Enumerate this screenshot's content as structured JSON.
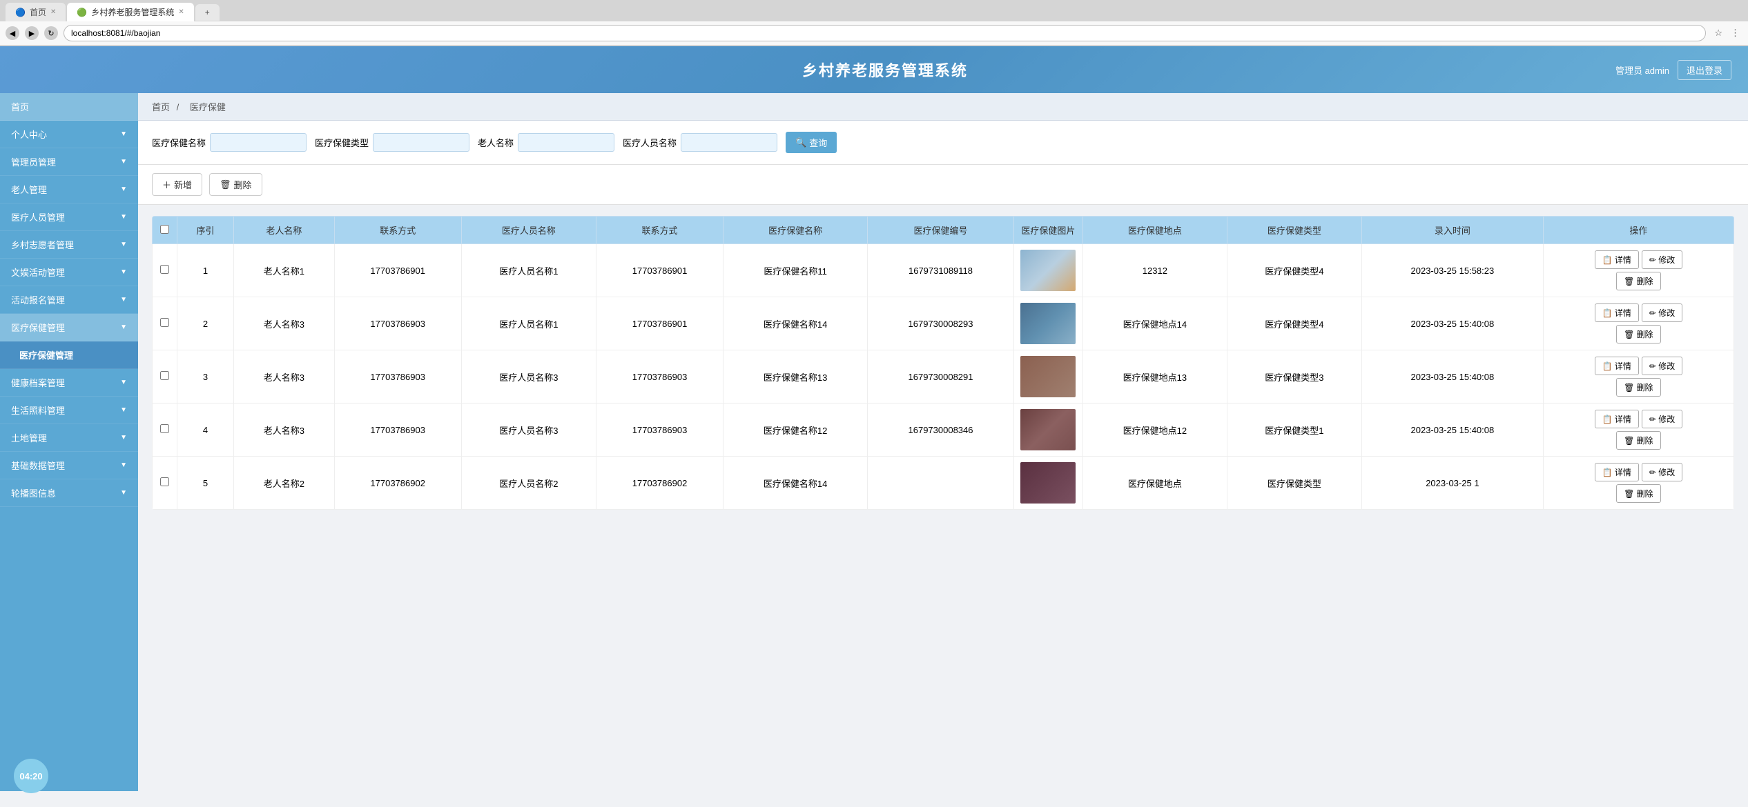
{
  "browser": {
    "tabs": [
      {
        "label": "首页",
        "active": false,
        "icon": "🔵"
      },
      {
        "label": "乡村养老服务管理系统",
        "active": true,
        "icon": "🟢"
      }
    ],
    "address": "localhost:8081/#/baojian",
    "new_tab": "+"
  },
  "header": {
    "title": "乡村养老服务管理系统",
    "admin_label": "管理员 admin",
    "logout_label": "退出登录"
  },
  "breadcrumb": {
    "home": "首页",
    "separator": "/",
    "current": "医疗保健"
  },
  "search": {
    "field1_label": "医疗保健名称",
    "field1_placeholder": "",
    "field2_label": "医疗保健类型",
    "field2_placeholder": "",
    "field3_label": "老人名称",
    "field3_placeholder": "",
    "field4_label": "医疗人员名称",
    "field4_placeholder": "",
    "search_btn": "查询"
  },
  "actions": {
    "add": "+ 新增",
    "delete": "删除"
  },
  "table": {
    "columns": [
      "序引",
      "老人名称",
      "联系方式",
      "医疗人员名称",
      "联系方式",
      "医疗保健名称",
      "医疗保健编号",
      "医疗保健图片",
      "医疗保健地点",
      "医疗保健类型",
      "录入时间",
      "操作"
    ],
    "rows": [
      {
        "id": 1,
        "elder_name": "老人名称1",
        "contact": "17703786901",
        "staff_name": "医疗人员名称1",
        "staff_contact": "17703786901",
        "health_name": "医疗保健名称11",
        "health_code": "1679731089118",
        "location": "12312",
        "type": "医疗保健类型4",
        "time": "2023-03-25 15:58:23",
        "img_class": "img-row1"
      },
      {
        "id": 2,
        "elder_name": "老人名称3",
        "contact": "17703786903",
        "staff_name": "医疗人员名称1",
        "staff_contact": "17703786901",
        "health_name": "医疗保健名称14",
        "health_code": "1679730008293",
        "location": "医疗保健地点14",
        "type": "医疗保健类型4",
        "time": "2023-03-25 15:40:08",
        "img_class": "img-row2"
      },
      {
        "id": 3,
        "elder_name": "老人名称3",
        "contact": "17703786903",
        "staff_name": "医疗人员名称3",
        "staff_contact": "17703786903",
        "health_name": "医疗保健名称13",
        "health_code": "1679730008291",
        "location": "医疗保健地点13",
        "type": "医疗保健类型3",
        "time": "2023-03-25 15:40:08",
        "img_class": "img-row3"
      },
      {
        "id": 4,
        "elder_name": "老人名称3",
        "contact": "17703786903",
        "staff_name": "医疗人员名称3",
        "staff_contact": "17703786903",
        "health_name": "医疗保健名称12",
        "health_code": "1679730008346",
        "location": "医疗保健地点12",
        "type": "医疗保健类型1",
        "time": "2023-03-25 15:40:08",
        "img_class": "img-row4"
      },
      {
        "id": 5,
        "elder_name": "老人名称2",
        "contact": "17703786902",
        "staff_name": "医疗人员名称2",
        "staff_contact": "17703786902",
        "health_name": "医疗保健名称14",
        "health_code": "",
        "location": "医疗保健地点",
        "type": "医疗保健类型",
        "time": "2023-03-25 1",
        "img_class": "img-row5"
      }
    ],
    "btn_detail": "详情",
    "btn_edit": "修改",
    "btn_delete": "删除"
  },
  "sidebar": {
    "items": [
      {
        "label": "首页",
        "active": true,
        "has_sub": false
      },
      {
        "label": "个人中心",
        "active": false,
        "has_sub": true
      },
      {
        "label": "管理员管理",
        "active": false,
        "has_sub": true
      },
      {
        "label": "老人管理",
        "active": false,
        "has_sub": true
      },
      {
        "label": "医疗人员管理",
        "active": false,
        "has_sub": true
      },
      {
        "label": "乡村志愿者管理",
        "active": false,
        "has_sub": true
      },
      {
        "label": "文娱活动管理",
        "active": false,
        "has_sub": true
      },
      {
        "label": "活动报名管理",
        "active": false,
        "has_sub": true
      },
      {
        "label": "医疗保健管理",
        "active": true,
        "has_sub": true
      },
      {
        "label": "医疗保健管理",
        "active": true,
        "has_sub": false,
        "is_child": true
      },
      {
        "label": "健康档案管理",
        "active": false,
        "has_sub": true
      },
      {
        "label": "生活照料管理",
        "active": false,
        "has_sub": true
      },
      {
        "label": "土地管理",
        "active": false,
        "has_sub": true
      },
      {
        "label": "基础数据管理",
        "active": false,
        "has_sub": true
      },
      {
        "label": "轮播图信息",
        "active": false,
        "has_sub": true
      }
    ]
  },
  "clock": {
    "time": "04:20"
  }
}
